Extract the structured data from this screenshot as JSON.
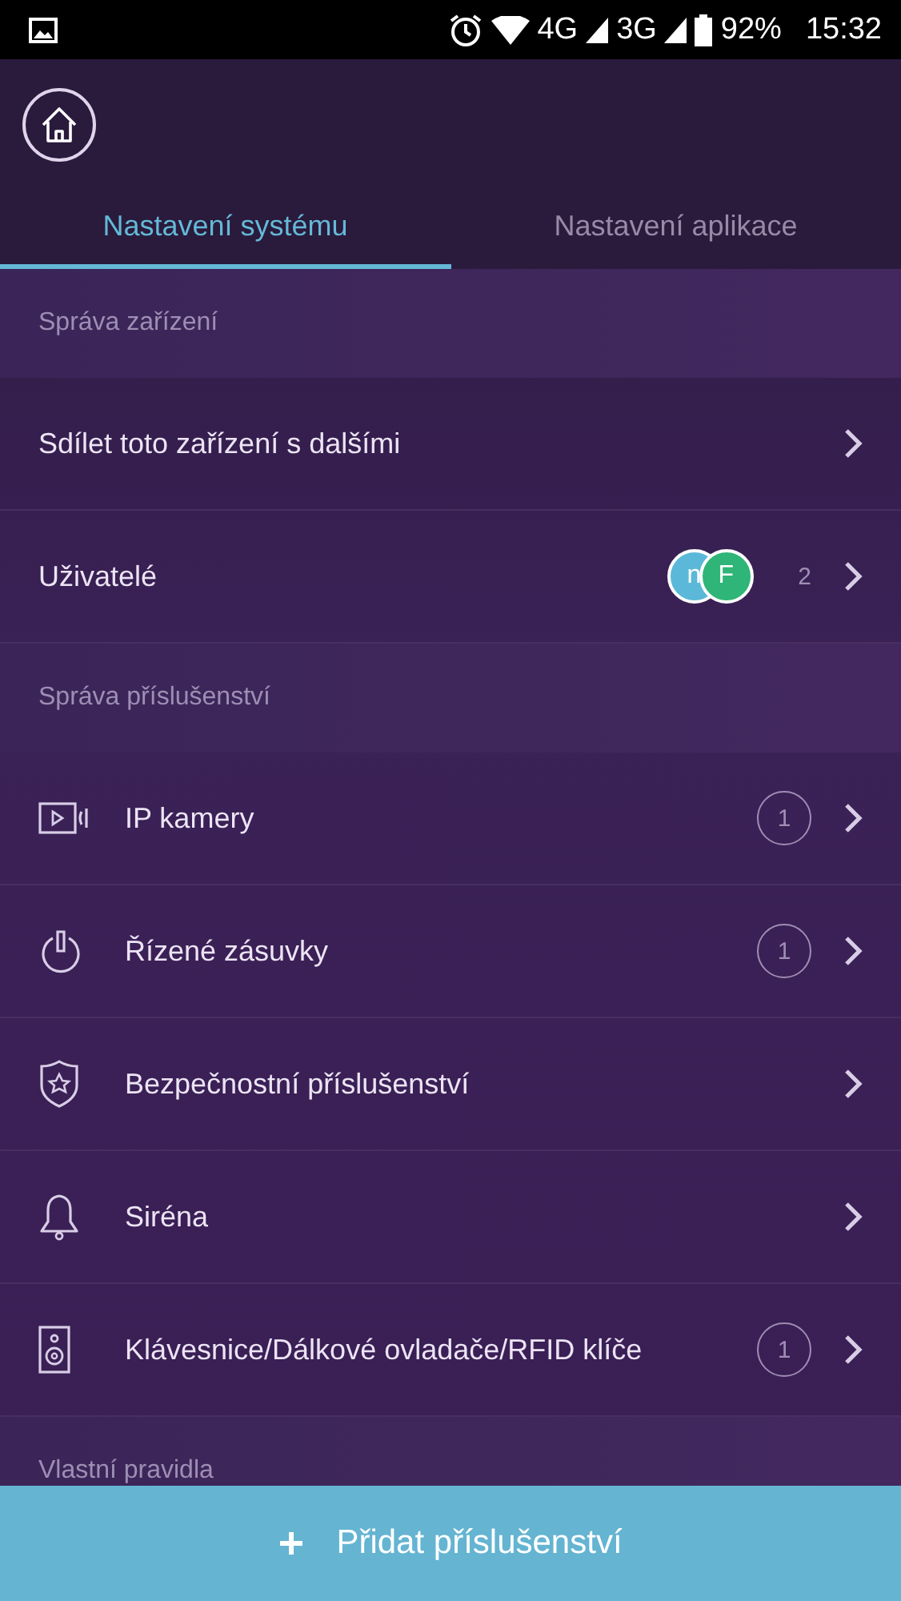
{
  "status_bar": {
    "network_1": "4G",
    "network_2": "3G",
    "battery": "92%",
    "time": "15:32"
  },
  "tabs": [
    {
      "label": "Nastavení systému",
      "selected": true
    },
    {
      "label": "Nastavení aplikace",
      "selected": false
    }
  ],
  "sections": [
    {
      "title": "Správa zařízení",
      "items": [
        {
          "kind": "plain",
          "label": "Sdílet toto zařízení s dalšími"
        },
        {
          "kind": "plain",
          "label": "Uživatelé",
          "avatars": [
            {
              "initial": "n",
              "color": "#5bb8d8"
            },
            {
              "initial": "F",
              "color": "#2fb577"
            }
          ],
          "count": "2"
        }
      ]
    },
    {
      "title": "Správa příslušenství",
      "items": [
        {
          "kind": "accessory",
          "label": "IP kamery",
          "badge": "1"
        },
        {
          "kind": "accessory",
          "label": "Řízené zásuvky",
          "badge": "1"
        },
        {
          "kind": "accessory",
          "label": "Bezpečnostní příslušenství"
        },
        {
          "kind": "accessory",
          "label": "Siréna"
        },
        {
          "kind": "accessory",
          "label": "Klávesnice/Dálkové ovladače/RFID klíče",
          "badge": "1"
        }
      ]
    },
    {
      "title": "Vlastní pravidla"
    }
  ],
  "add_button": {
    "label": "Přidat příslušenství"
  }
}
